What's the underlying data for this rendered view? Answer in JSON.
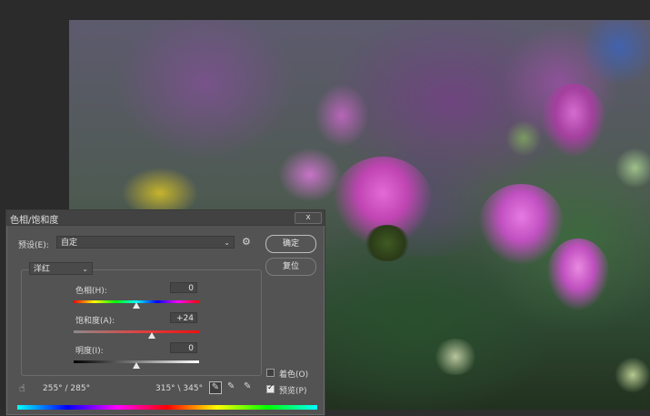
{
  "dialog": {
    "title": "色相/饱和度",
    "close_label": "x",
    "preset_label": "预设(E):",
    "preset_value": "自定",
    "channel_value": "洋红",
    "ok_label": "确定",
    "cancel_label": "复位",
    "hue_label": "色相(H):",
    "hue_value": "0",
    "saturation_label": "饱和度(A):",
    "saturation_value": "+24",
    "lightness_label": "明度(I):",
    "lightness_value": "0",
    "colorize_label": "着色(O)",
    "preview_label": "预览(P)",
    "colorize_checked": false,
    "preview_checked": true,
    "range_left": "255° / 285°",
    "range_right": "315° \\ 345°",
    "hue_slider": 0.5,
    "saturation_slider": 0.62,
    "lightness_slider": 0.5
  },
  "colors": {
    "dialog_bg": "#535353",
    "workspace_bg": "#2b2b2b"
  }
}
